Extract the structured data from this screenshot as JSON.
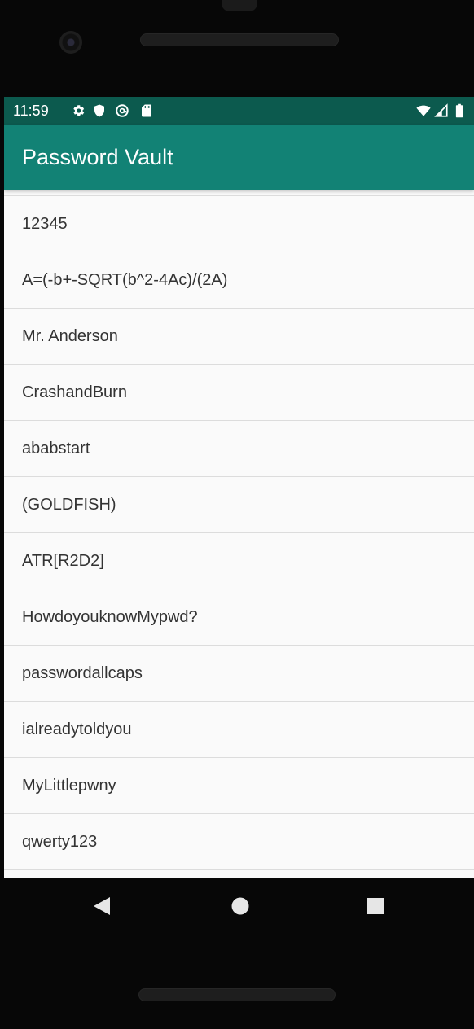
{
  "status_bar": {
    "time": "11:59",
    "left_icons": [
      "gear-icon",
      "shield-icon",
      "at-sign-icon",
      "sd-card-icon"
    ],
    "right_icons": [
      "wifi-icon",
      "signal-icon",
      "battery-icon"
    ]
  },
  "app_bar": {
    "title": "Password Vault",
    "color": "#128275",
    "status_color": "#0c5a4e"
  },
  "list": {
    "items": [
      "12345",
      "A=(-b+-SQRT(b^2-4Ac)/(2A)",
      "Mr. Anderson",
      "CrashandBurn",
      "ababstart",
      "(GOLDFISH)",
      "ATR[R2D2]",
      "HowdoyouknowMypwd?",
      "passwordallcaps",
      "ialreadytoldyou",
      "MyLittlepwny",
      "qwerty123"
    ]
  },
  "nav_bar": {
    "buttons": [
      "back-icon",
      "home-icon",
      "recents-icon"
    ]
  }
}
